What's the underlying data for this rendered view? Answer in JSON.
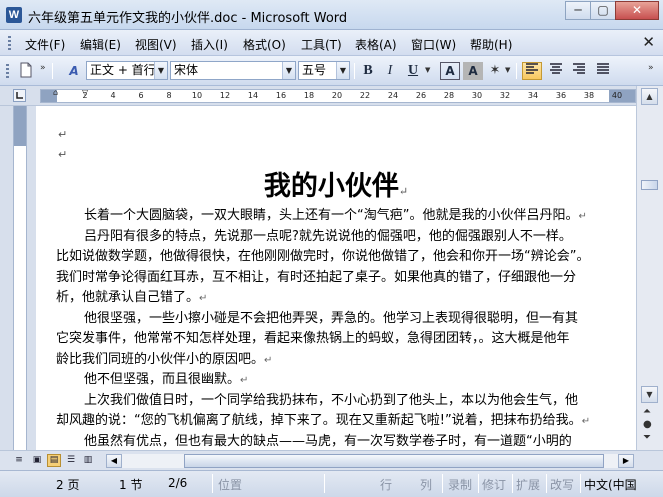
{
  "window": {
    "app_icon": "W",
    "title": "六年级第五单元作文我的小伙伴.doc - Microsoft Word",
    "minimize": "─",
    "maximize": "▢",
    "close": "✕"
  },
  "menu": {
    "items": [
      "文件(F)",
      "编辑(E)",
      "视图(V)",
      "插入(I)",
      "格式(O)",
      "工具(T)",
      "表格(A)",
      "窗口(W)",
      "帮助(H)"
    ],
    "close_doc": "✕"
  },
  "toolbar": {
    "style_value": "正文 + 首行",
    "font_value": "宋体",
    "size_value": "五号",
    "bold": "B",
    "italic": "I",
    "underline": "U",
    "font_border": "A",
    "char_shading": "A",
    "icons": [
      "new-document-icon",
      "styles-icon",
      "align-left-icon",
      "center-icon",
      "align-right-icon",
      "justify-icon"
    ]
  },
  "ruler": {
    "ticks": [
      "2",
      "4",
      "6",
      "8",
      "10",
      "12",
      "14",
      "16",
      "18",
      "20",
      "22",
      "24",
      "26",
      "28",
      "30",
      "32",
      "34",
      "36",
      "38",
      "40"
    ]
  },
  "document": {
    "title": "我的小伙伴",
    "para_mark": "↵",
    "paragraphs": [
      "长着一个大圆脑袋，一双大眼睛，头上还有一个“淘气疤”。他就是我的小伙伴吕丹阳。",
      "吕丹阳有很多的特点，先说那一点呢?就先说说他的倔强吧，他的倔强跟别人不一样。",
      "比如说做数学题，他做得很快，在他刚刚做完时，你说他做错了，他会和你开一场“辨论会”。",
      "我们时常争论得面红耳赤，互不相让，有时还拍起了桌子。如果他真的错了，仔细跟他一分",
      "析，他就承认自己错了。",
      "他很坚强，一些小擦小碰是不会把他弄哭，弄急的。他学习上表现得很聪明，但一有其",
      "它突发事件，他常常不知怎样处理，看起来像热锅上的蚂蚁，急得团团转，。这大概是他年",
      "龄比我们同班的小伙伴小的原因吧。",
      "他不但坚强，而且很幽默。",
      "上次我们做值日时，一个同学给我扔抹布，不小心扔到了他头上，本以为他会生气，他",
      "却风趣的说：“您的飞机偏离了航线，掉下来了。现在又重新起飞啦!”说着，把抹布扔给我。",
      "他虽然有优点，但也有最大的缺点——马虎，有一次写数学卷子时，有一道题“小明的"
    ]
  },
  "status": {
    "page": "2 页",
    "section": "1 节",
    "page_of": "2/6",
    "at": "位置",
    "line": "行",
    "col": "列",
    "rec": "录制",
    "trk": "修订",
    "ext": "扩展",
    "ovr": "改写",
    "lang": "中文(中国"
  }
}
